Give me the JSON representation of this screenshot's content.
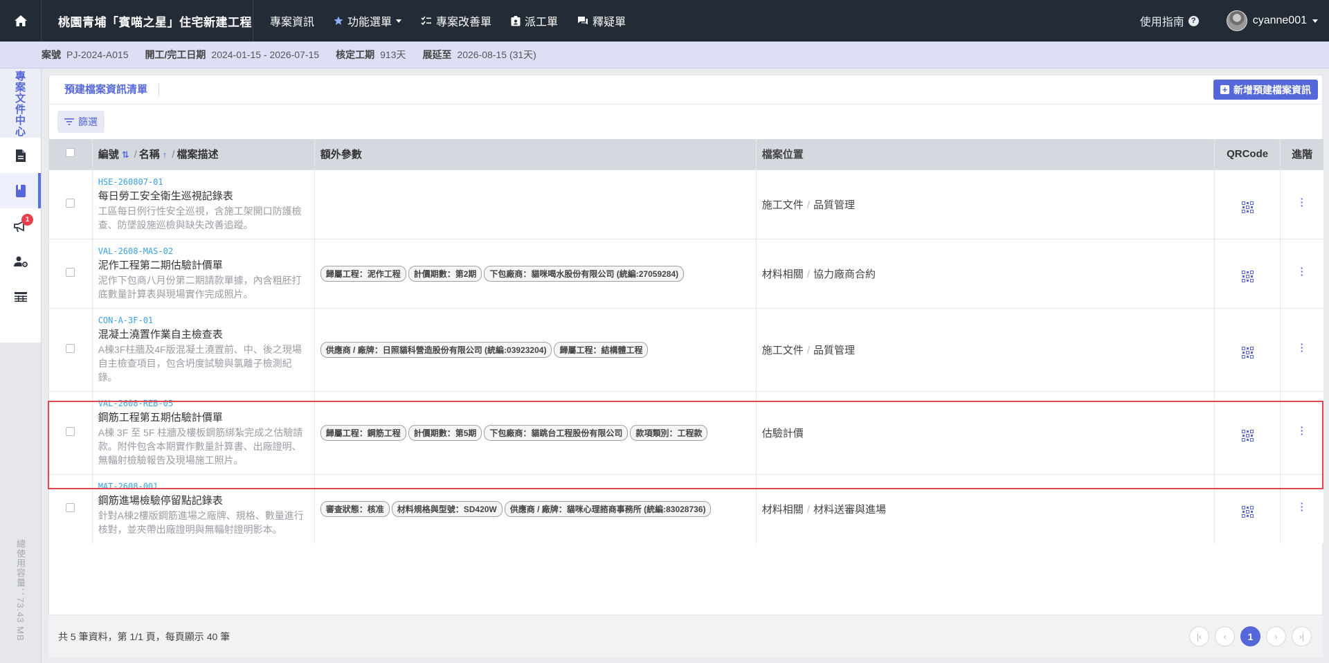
{
  "header": {
    "project_title": "桃園青埔「賓喵之星」住宅新建工程",
    "nav": [
      {
        "label": "專案資訊",
        "icon": "none"
      },
      {
        "label": "功能選單",
        "icon": "star-icon"
      },
      {
        "label": "專案改善單",
        "icon": "checklist-icon"
      },
      {
        "label": "派工單",
        "icon": "badge-icon"
      },
      {
        "label": "釋疑單",
        "icon": "chat-icon"
      }
    ],
    "guide_label": "使用指南",
    "username": "cyanne001"
  },
  "info": {
    "case_no_label": "案號",
    "case_no": "PJ-2024-A015",
    "dates_label": "開工/完工日期",
    "dates": "2024-01-15 - 2026-07-15",
    "period_label": "核定工期",
    "period": "913天",
    "extension_label": "展延至",
    "extension": "2026-08-15 (31天)"
  },
  "sidebar": {
    "title": "專案文件中心",
    "items": [
      {
        "icon": "document-icon",
        "active": false
      },
      {
        "icon": "book-icon",
        "active": true
      },
      {
        "icon": "megaphone-icon",
        "active": false,
        "badge": "1"
      },
      {
        "icon": "user-settings-icon",
        "active": false
      },
      {
        "icon": "table-icon",
        "active": false
      }
    ],
    "usage": "總使用容量：73.43 MB"
  },
  "main": {
    "title": "預建檔案資訊清單",
    "add_button": "新增預建檔案資訊",
    "filter_button": "篩選",
    "columns": {
      "code": "編號",
      "name": "名稱",
      "desc": "檔案描述",
      "extra": "額外參數",
      "location": "檔案位置",
      "qrcode": "QRCode",
      "advanced": "進階"
    },
    "rows": [
      {
        "code": "HSE-260807-01",
        "name": "每日勞工安全衛生巡視記錄表",
        "desc": "工區每日例行性安全巡視，含施工架開口防護檢查、防墜設施巡檢與缺失改善追蹤。",
        "tags": [],
        "location": [
          "施工文件",
          "品質管理"
        ]
      },
      {
        "code": "VAL-2608-MAS-02",
        "name": "泥作工程第二期估驗計價單",
        "desc": "泥作下包商八月份第二期請款單據，內含粗胚打底數量計算表與現場實作完成照片。",
        "tags": [
          "歸屬工程：泥作工程",
          "計價期數：第2期",
          "下包廠商：貓咪喝水股份有限公司 (統編:27059284)"
        ],
        "location": [
          "材料相關",
          "協力廠商合約"
        ]
      },
      {
        "code": "CON-A-3F-01",
        "name": "混凝土澆置作業自主檢查表",
        "desc": "A棟3F柱牆及4F版混凝土澆置前、中、後之現場自主檢查項目，包含坍度試驗與氯離子檢測紀錄。",
        "tags": [
          "供應商 / 廠牌：日照貓科營造股份有限公司 (統編:03923204)",
          "歸屬工程：結構體工程"
        ],
        "location": [
          "施工文件",
          "品質管理"
        ]
      },
      {
        "code": "VAL-2608-REB-05",
        "name": "鋼筋工程第五期估驗計價單",
        "desc": "A棟 3F 至 5F 柱牆及樓板鋼筋綁紮完成之估驗請款。附件包含本期實作數量計算書、出廠證明、無輻射檢驗報告及現場施工照片。",
        "tags": [
          "歸屬工程：鋼筋工程",
          "計價期數：第5期",
          "下包廠商：貓跳台工程股份有限公司",
          "款項類別：工程款"
        ],
        "location": [
          "估驗計價"
        ]
      },
      {
        "code": "MAT-2608-001",
        "name": "鋼筋進場檢驗停留點記錄表",
        "desc": "針對A棟2樓版鋼筋進場之廠牌、規格、數量進行核對，並夾帶出廠證明與無輻射證明影本。",
        "tags": [
          "審查狀態：核准",
          "材料規格與型號：SD420W",
          "供應商 / 廠牌：貓咪心理諮商事務所 (統編:83028736)"
        ],
        "location": [
          "材料相關",
          "材料送審與進場"
        ]
      }
    ],
    "footer": "共 5 筆資料，第 1/1 頁，每頁顯示 40 筆",
    "current_page": "1"
  },
  "colors": {
    "accent": "#5567d9",
    "topbar": "#222b36",
    "code": "#3aa0e6",
    "selected_outline": "#e0464e",
    "badge": "#e8414b"
  }
}
